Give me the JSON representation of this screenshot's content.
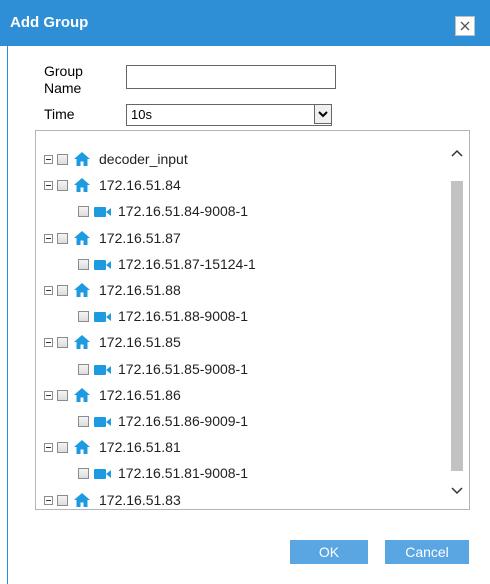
{
  "dialog": {
    "title": "Add Group",
    "close_icon": "close-icon"
  },
  "form": {
    "group_name_label": "Group Name",
    "group_name_value": "",
    "time_label": "Time",
    "time_value": "10s"
  },
  "tree": {
    "items": [
      {
        "label": "decoder_input",
        "icon": "home-icon",
        "level": 0
      },
      {
        "label": "172.16.51.84",
        "icon": "home-icon",
        "level": 0
      },
      {
        "label": "172.16.51.84-9008-1",
        "icon": "camera-icon",
        "level": 1
      },
      {
        "label": "172.16.51.87",
        "icon": "home-icon",
        "level": 0
      },
      {
        "label": "172.16.51.87-15124-1",
        "icon": "camera-icon",
        "level": 1
      },
      {
        "label": "172.16.51.88",
        "icon": "home-icon",
        "level": 0
      },
      {
        "label": "172.16.51.88-9008-1",
        "icon": "camera-icon",
        "level": 1
      },
      {
        "label": "172.16.51.85",
        "icon": "home-icon",
        "level": 0
      },
      {
        "label": "172.16.51.85-9008-1",
        "icon": "camera-icon",
        "level": 1
      },
      {
        "label": "172.16.51.86",
        "icon": "home-icon",
        "level": 0
      },
      {
        "label": "172.16.51.86-9009-1",
        "icon": "camera-icon",
        "level": 1
      },
      {
        "label": "172.16.51.81",
        "icon": "home-icon",
        "level": 0
      },
      {
        "label": "172.16.51.81-9008-1",
        "icon": "camera-icon",
        "level": 1
      },
      {
        "label": "172.16.51.83",
        "icon": "home-icon",
        "level": 0
      }
    ]
  },
  "buttons": {
    "ok_label": "OK",
    "cancel_label": "Cancel"
  },
  "colors": {
    "titlebar": "#2f8fd6",
    "icon_blue": "#1e9be0",
    "button": "#5aa6e3"
  }
}
